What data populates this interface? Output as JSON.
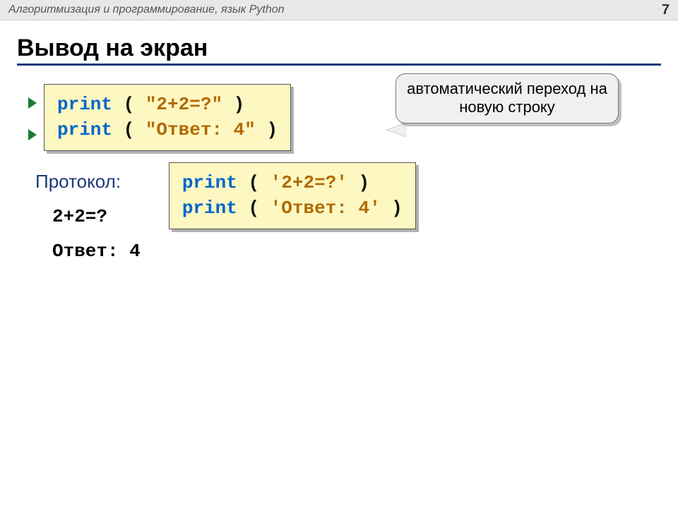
{
  "header": {
    "course_title": "Алгоритмизация и программирование, язык Python",
    "page_number": "7"
  },
  "slide": {
    "title": "Вывод на экран"
  },
  "code1": {
    "line1": {
      "kw": "print",
      "open": " ( ",
      "str": "\"2+2=?\"",
      "close": " )"
    },
    "line2": {
      "kw": "print",
      "open": " ( ",
      "str": "\"Ответ: 4\"",
      "close": " )"
    }
  },
  "callout": {
    "text": "автоматический переход на новую строку"
  },
  "protocol": {
    "label": "Протокол:",
    "line1": "2+2=?",
    "line2": "Ответ: 4"
  },
  "code2": {
    "line1": {
      "kw": "print",
      "open": " ( ",
      "str": "'2+2=?'",
      "close": " )"
    },
    "line2": {
      "kw": "print",
      "open": " ( ",
      "str": "'Ответ: 4'",
      "close": " )"
    }
  }
}
